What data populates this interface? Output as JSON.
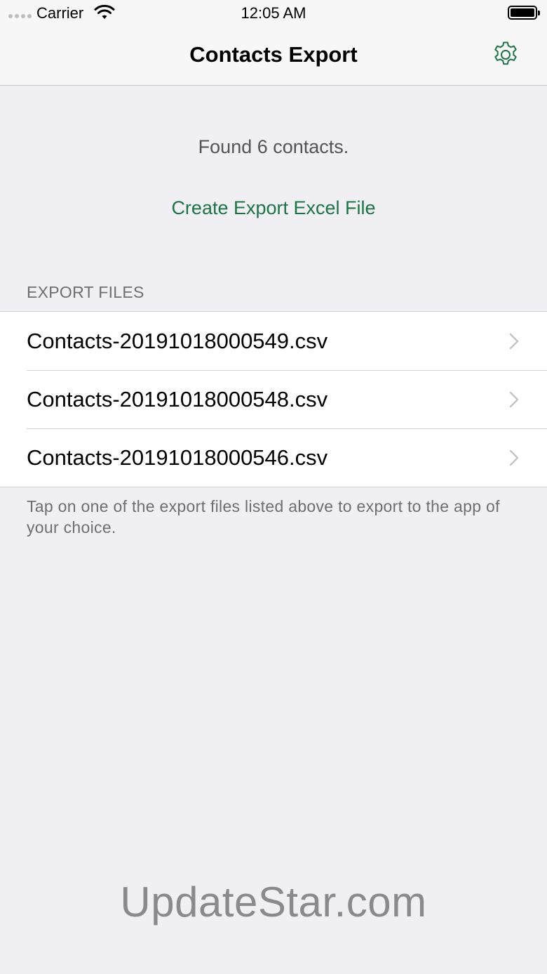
{
  "status_bar": {
    "carrier": "Carrier",
    "time": "12:05 AM"
  },
  "nav": {
    "title": "Contacts Export",
    "settings_icon": "gear-icon"
  },
  "main": {
    "found_text": "Found 6 contacts.",
    "create_button_label": "Create Export Excel File",
    "section_header": "EXPORT FILES",
    "files": [
      {
        "name": "Contacts-20191018000549.csv"
      },
      {
        "name": "Contacts-20191018000548.csv"
      },
      {
        "name": "Contacts-20191018000546.csv"
      }
    ],
    "footer": "Tap on one of the export files listed above to export to the app of your choice."
  },
  "watermark": "UpdateStar.com",
  "colors": {
    "accent": "#1d7444",
    "background": "#efeff4",
    "secondary_text": "#6d6d72"
  }
}
